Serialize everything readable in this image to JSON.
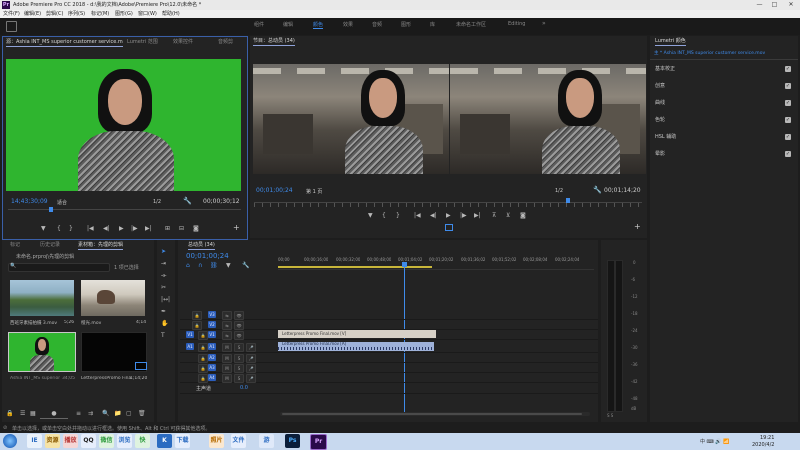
{
  "window": {
    "title": "Adobe Premiere Pro CC 2018 - d:\\我的文档\\Adobe\\Premiere Pro\\12.0\\未命名 *",
    "minimize": "—",
    "maximize": "□",
    "close": "✕"
  },
  "menubar": [
    "文件(F)",
    "编辑(E)",
    "剪辑(C)",
    "序列(S)",
    "标记(M)",
    "图形(G)",
    "窗口(W)",
    "帮助(H)"
  ],
  "workspaces": [
    "组件",
    "编辑",
    "颜色",
    "效果",
    "音频",
    "图形",
    "库",
    "未命名工作区",
    "Editing"
  ],
  "workspace_more": "»",
  "source_panel": {
    "tabs": [
      "源：Ashia INT_MS superior customer service.mov",
      "Lumetri 范围",
      "效果控件",
      "音频剪"
    ],
    "timecode_left": "14;43;30;09",
    "fit": "适合",
    "scale": "1/2",
    "timecode_right": "00;00;30;12"
  },
  "program_panel": {
    "tab": "节目：总动员 (34)",
    "timecode_left": "00;01;00;24",
    "page": "第 1 页",
    "scale": "1/2",
    "timecode_right": "00;01;14;20"
  },
  "lumetri": {
    "tab": "Lumetri 颜色",
    "clip": "主 * Ashia INT_MS superior customer service.mov",
    "sections": [
      "基本校正",
      "创意",
      "曲线",
      "色轮",
      "HSL 辅助",
      "晕影"
    ],
    "check": "✓"
  },
  "project": {
    "tabs": [
      "标记",
      "历史记录",
      "素材箱：先理的剪辑"
    ],
    "path": "未命名.prproj\\先理的剪辑",
    "search_placeholder": "",
    "items_count": "1 项已选择",
    "items": [
      {
        "name": "西班牙素描拍摄 3.mov",
        "duration": "5;26"
      },
      {
        "name": "橙光.mov",
        "duration": "4;14"
      },
      {
        "name": "Ashia INT_MS superior customer ser...",
        "duration": "34;05"
      },
      {
        "name": "LetterpressPromo Fina...",
        "duration": "1;14;20"
      }
    ]
  },
  "timeline": {
    "tab": "总动员 (34)",
    "timecode": "00;01;00;24",
    "ruler": [
      "00;00",
      "00;00;16;00",
      "00;00;32;00",
      "00;00;48;00",
      "00;01;04;02",
      "00;01;20;02",
      "00;01;36;02",
      "00;01;52;02",
      "00;02;08;04",
      "00;02;24;04"
    ],
    "video_tracks": [
      "V3",
      "V2",
      "V1"
    ],
    "audio_tracks": [
      "A1",
      "A2",
      "A3",
      "A4"
    ],
    "source_patch_v": "V1",
    "source_patch_a": "A1",
    "master": "主声道",
    "master_value": "0.0",
    "clip_video": "Letterpress Promo Final.mov [V]",
    "clip_audio": "Letterpress Promo Final.mov [A]"
  },
  "meter": {
    "labels": [
      "0",
      "-6",
      "-12",
      "-18",
      "-24",
      "-30",
      "-36",
      "-42",
      "-48",
      "dB"
    ],
    "footer": "S  S"
  },
  "status": {
    "text": "单击以选择，或单击空白处并拖动以进行框选。使用 Shift、Alt 和 Ctrl 可获得其他选项。"
  },
  "taskbar": {
    "apps": [
      "IE",
      "资源",
      "播放",
      "QQ",
      "微信",
      "浏览",
      "快",
      "K",
      "下载",
      "照片",
      "文件",
      "游",
      "Ps",
      "Pr"
    ],
    "tray": "中 ⌨ 🔊 📶",
    "time": "19:21",
    "date": "2020/4/2"
  },
  "colors": {
    "accent": "#3f8bea",
    "app_bg": "#1d1d1d",
    "panel_bg": "#232323",
    "greenscreen": "#2fb52f",
    "taskbar": "#c8d9ef"
  }
}
